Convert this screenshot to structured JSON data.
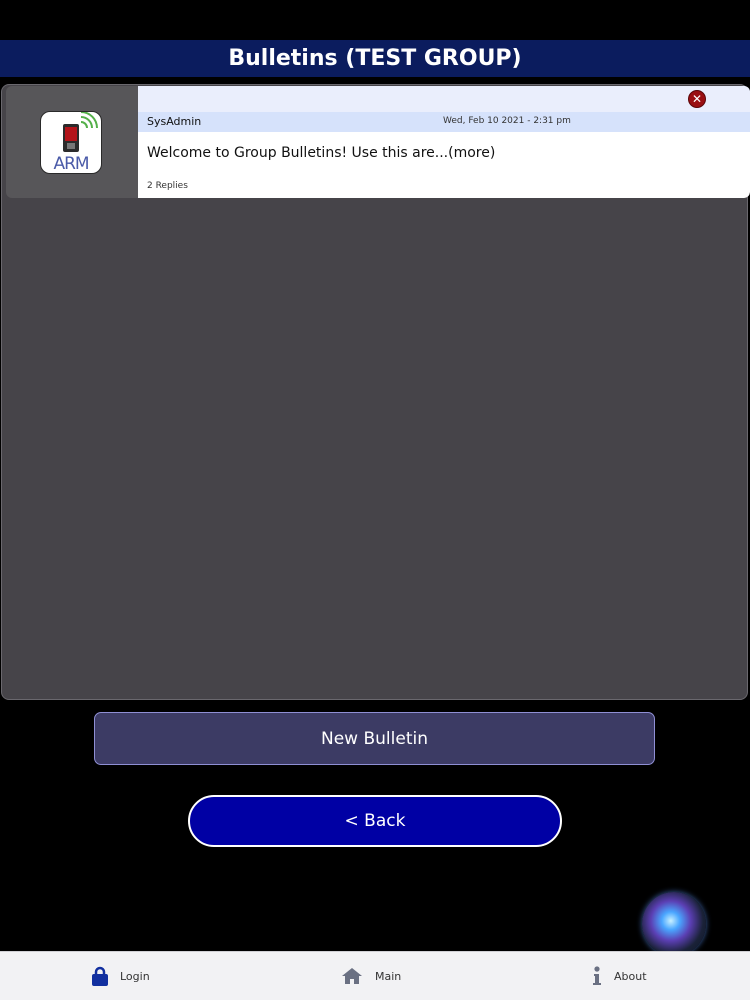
{
  "header": {
    "title": "Bulletins (TEST GROUP)"
  },
  "bulletins": [
    {
      "logo_text": "ARM",
      "author": "SysAdmin",
      "datetime": "Wed, Feb 10 2021 - 2:31 pm",
      "message": "Welcome to Group Bulletins! Use this are...(more)",
      "replies": "2 Replies",
      "delete_icon": "close-icon"
    }
  ],
  "buttons": {
    "new_bulletin": "New Bulletin",
    "back": "< Back"
  },
  "bottom_nav": [
    {
      "label": "Login",
      "icon": "lock-icon"
    },
    {
      "label": "Main",
      "icon": "home-icon"
    },
    {
      "label": "About",
      "icon": "info-icon"
    }
  ],
  "colors": {
    "header_bg": "#0b1c5e",
    "back_button_bg": "#0000a4",
    "new_bulletin_bg": "#3c3b64",
    "delete_red": "#9a0f12"
  }
}
